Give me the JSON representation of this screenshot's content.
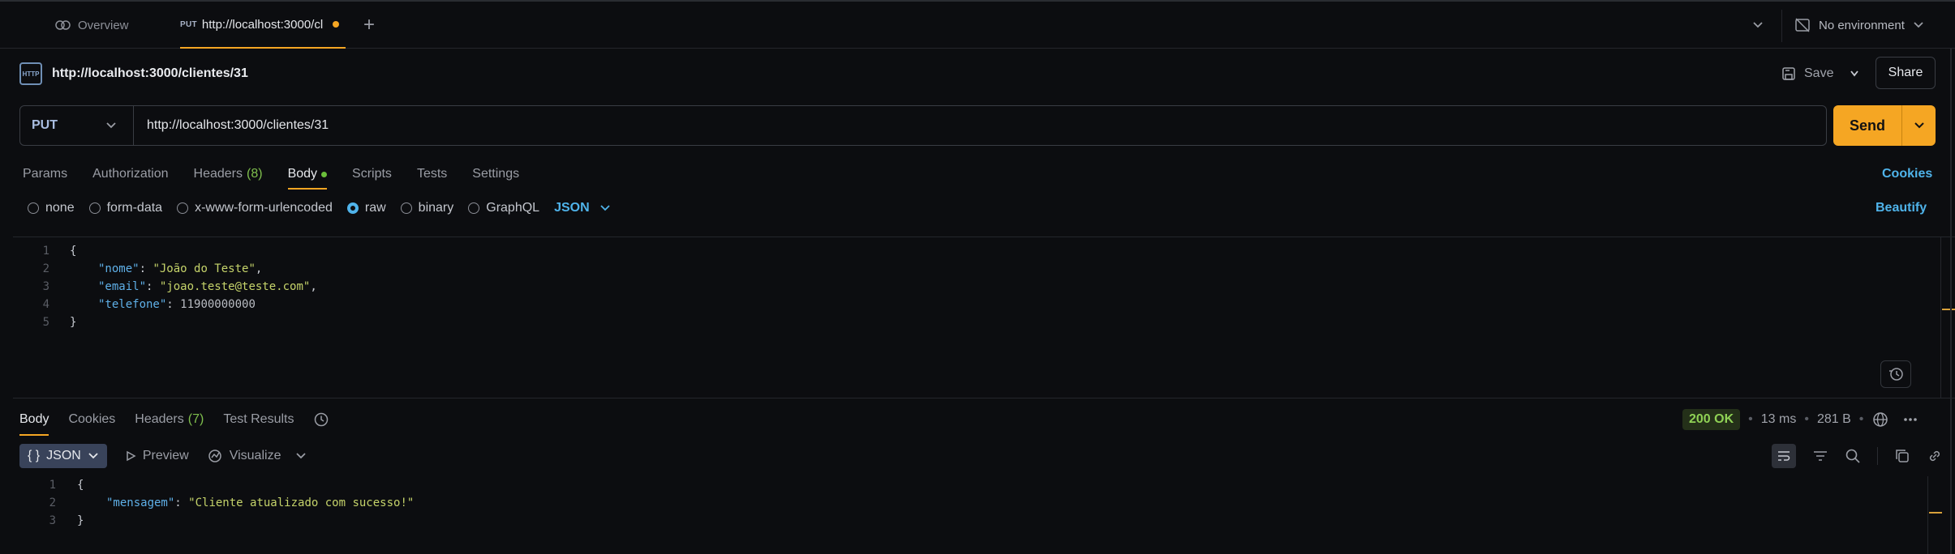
{
  "tabs": {
    "overview": "Overview",
    "request_method": "PUT",
    "request_title": "http://localhost:3000/cl",
    "environment": "No environment"
  },
  "request": {
    "title": "http://localhost:3000/clientes/31",
    "save_label": "Save",
    "share_label": "Share",
    "method": "PUT",
    "url": "http://localhost:3000/clientes/31",
    "send_label": "Send",
    "tabs": {
      "params": "Params",
      "authorization": "Authorization",
      "headers": "Headers",
      "headers_count": "(8)",
      "body": "Body",
      "scripts": "Scripts",
      "tests": "Tests",
      "settings": "Settings"
    },
    "cookies_label": "Cookies",
    "body_types": {
      "none": "none",
      "form_data": "form-data",
      "urlencoded": "x-www-form-urlencoded",
      "raw": "raw",
      "binary": "binary",
      "graphql": "GraphQL"
    },
    "body_format": "JSON",
    "beautify_label": "Beautify",
    "body_lines": [
      {
        "n": "1",
        "open": "{"
      },
      {
        "n": "2",
        "key": "\"nome\"",
        "sep": ": ",
        "value": "\"João do Teste\"",
        "trail": ","
      },
      {
        "n": "3",
        "key": "\"email\"",
        "sep": ": ",
        "value": "\"joao.teste@teste.com\"",
        "trail": ","
      },
      {
        "n": "4",
        "key": "\"telefone\"",
        "sep": ": ",
        "number": "11900000000",
        "trail": ""
      },
      {
        "n": "5",
        "close": "}"
      }
    ]
  },
  "response": {
    "tabs": {
      "body": "Body",
      "cookies": "Cookies",
      "headers": "Headers",
      "headers_count": "(7)",
      "test_results": "Test Results"
    },
    "status": "200 OK",
    "time": "13 ms",
    "size": "281 B",
    "format": "JSON",
    "format_glyph": "{ }",
    "preview_label": "Preview",
    "visualize_label": "Visualize",
    "body_lines": [
      {
        "n": "1",
        "text": "{"
      },
      {
        "n": "2",
        "key": "\"mensagem\"",
        "sep": ": ",
        "value": "\"Cliente atualizado com sucesso!\""
      },
      {
        "n": "3",
        "text": "}"
      }
    ]
  },
  "colors": {
    "accent": "#f5a623",
    "link": "#4fb3ea",
    "json_key": "#5fb0e8",
    "json_string": "#c5d36a",
    "status_ok": "#8fd155"
  }
}
